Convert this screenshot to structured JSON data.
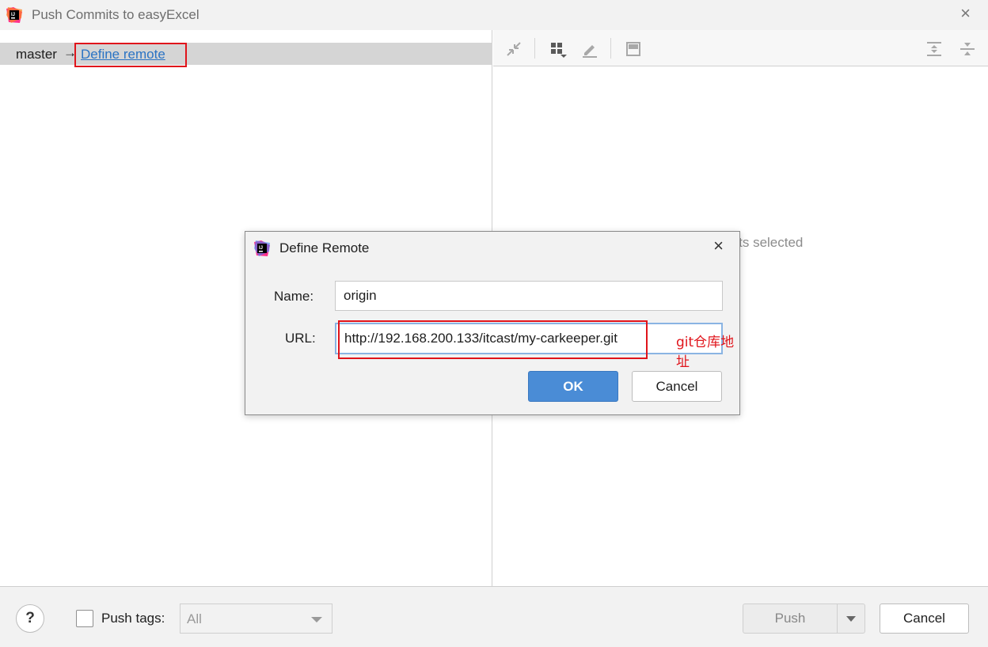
{
  "window": {
    "title": "Push Commits to easyExcel",
    "close_glyph": "×"
  },
  "branch": {
    "name": "master",
    "arrow": "→",
    "define_remote_link": "Define remote"
  },
  "details": {
    "empty_text": "No commits selected"
  },
  "toolbar_icons": [
    "collapse-icon",
    "group-by-icon",
    "edit-icon",
    "preview-icon",
    "expand-all-icon",
    "collapse-all-icon"
  ],
  "footer": {
    "help": "?",
    "push_tags_label": "Push tags:",
    "push_tags_select": "All",
    "push_label": "Push",
    "cancel_label": "Cancel"
  },
  "dialog": {
    "title": "Define Remote",
    "close_glyph": "×",
    "name_label": "Name:",
    "name_value": "origin",
    "url_label": "URL:",
    "url_value": "http://192.168.200.133/itcast/my-carkeeper.git",
    "annotation": "git仓库地址",
    "ok_label": "OK",
    "cancel_label": "Cancel"
  },
  "colors": {
    "accent": "#4a8cd6",
    "link": "#2a73c4",
    "annotation": "#e0141b"
  }
}
